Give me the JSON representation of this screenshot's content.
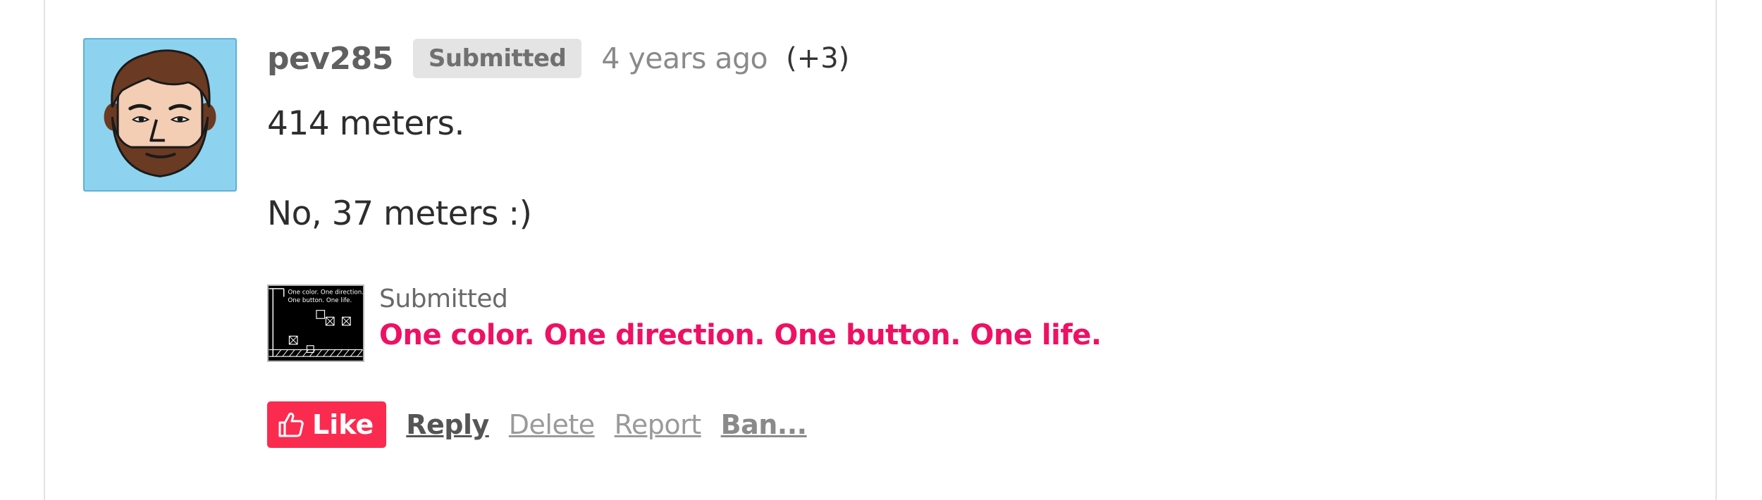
{
  "comment": {
    "author": "pev285",
    "badge": "Submitted",
    "time": "4 years ago",
    "votes": "(+3)",
    "lines": [
      "414 meters.",
      "No, 37 meters :)"
    ]
  },
  "game": {
    "status": "Submitted",
    "title": "One color. One direction. One button. One life.",
    "thumbnail_caption": [
      "One color. One direction.",
      "One button. One life."
    ]
  },
  "actions": {
    "like": "Like",
    "reply": "Reply",
    "delete": "Delete",
    "report": "Report",
    "ban": "Ban..."
  },
  "colors": {
    "like_button": "#fa2b4f",
    "game_title": "#ee1163",
    "avatar_bg": "#8dd3ef",
    "badge_bg": "#e4e4e4"
  },
  "icons": {
    "like": "thumbs-up-icon",
    "avatar": "bearded-man-avatar"
  }
}
